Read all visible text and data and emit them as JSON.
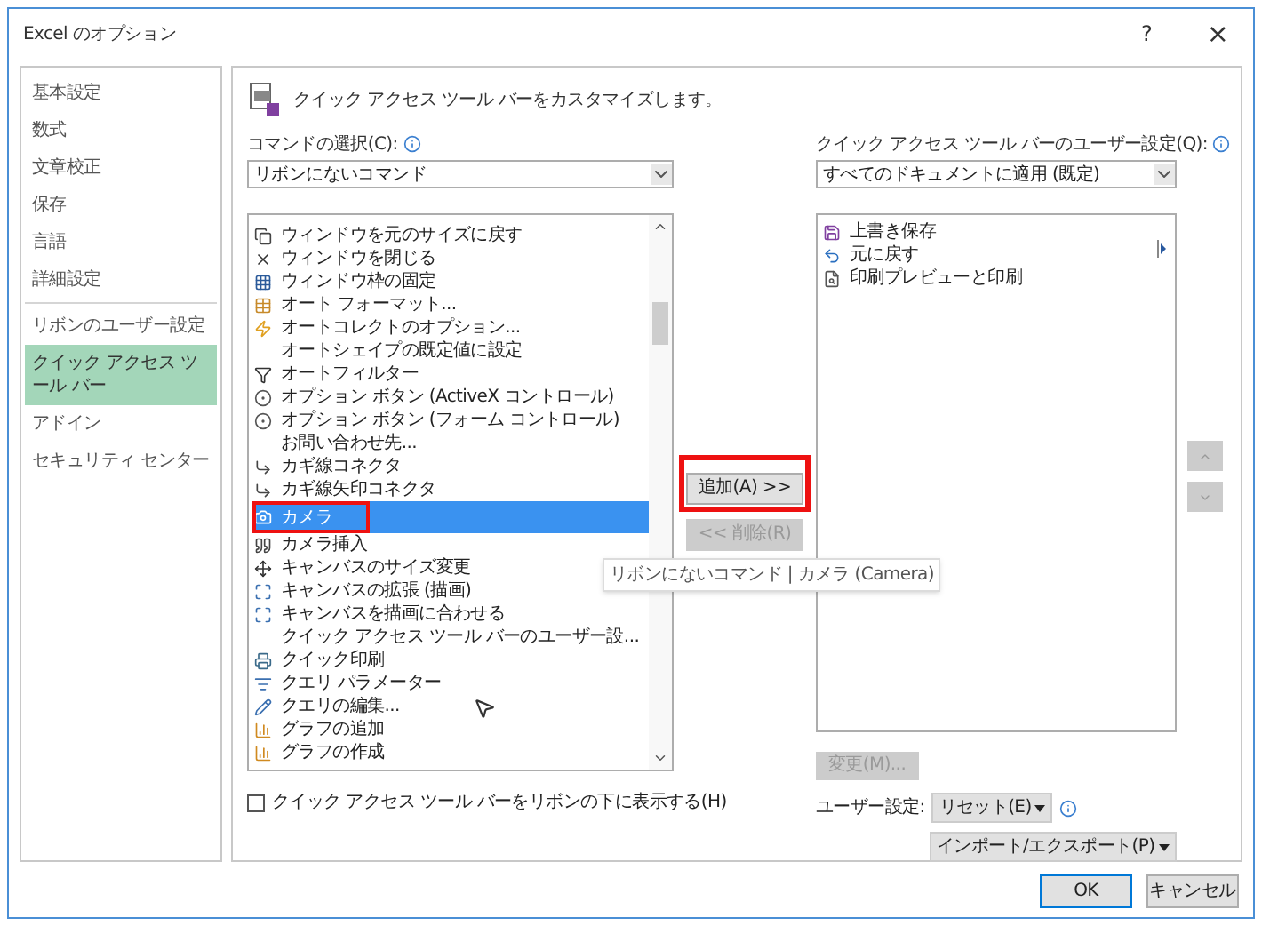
{
  "window": {
    "title": "Excel のオプション",
    "help_button": "?",
    "close_button": "×"
  },
  "sidebar": {
    "sections": [
      [
        {
          "label": "基本設定",
          "selected": false
        },
        {
          "label": "数式",
          "selected": false
        },
        {
          "label": "文章校正",
          "selected": false
        },
        {
          "label": "保存",
          "selected": false
        },
        {
          "label": "言語",
          "selected": false
        },
        {
          "label": "詳細設定",
          "selected": false
        }
      ],
      [
        {
          "label": "リボンのユーザー設定",
          "selected": false
        },
        {
          "label": "クイック アクセス ツール バー",
          "selected": true
        },
        {
          "label": "アドイン",
          "selected": false
        },
        {
          "label": "セキュリティ センター",
          "selected": false
        }
      ]
    ]
  },
  "main": {
    "heading": "クイック アクセス ツール バーをカスタマイズします。",
    "command_label": "コマンドの選択(C):",
    "command_dropdown": {
      "value": "リボンにないコマンド"
    },
    "commands": [
      {
        "label": "ウィンドウを元のサイズに戻す",
        "selected": false
      },
      {
        "label": "ウィンドウを閉じる",
        "selected": false
      },
      {
        "label": "ウィンドウ枠の固定",
        "selected": false
      },
      {
        "label": "オート フォーマット...",
        "selected": false
      },
      {
        "label": "オートコレクトのオプション...",
        "selected": false
      },
      {
        "label": "オートシェイプの既定値に設定",
        "selected": false
      },
      {
        "label": "オートフィルター",
        "selected": false
      },
      {
        "label": "オプション ボタン (ActiveX コントロール)",
        "selected": false
      },
      {
        "label": "オプション ボタン (フォーム コントロール)",
        "selected": false
      },
      {
        "label": "お問い合わせ先...",
        "selected": false
      },
      {
        "label": "カギ線コネクタ",
        "selected": false
      },
      {
        "label": "カギ線矢印コネクタ",
        "selected": false
      },
      {
        "label": "カメラ",
        "selected": true
      },
      {
        "label": "カメラ挿入",
        "selected": false
      },
      {
        "label": "キャンバスのサイズ変更",
        "selected": false
      },
      {
        "label": "キャンバスの拡張 (描画)",
        "selected": false
      },
      {
        "label": "キャンバスを描画に合わせる",
        "selected": false
      },
      {
        "label": "クイック アクセス ツール バーのユーザー設...",
        "selected": false
      },
      {
        "label": "クイック印刷",
        "selected": false
      },
      {
        "label": "クエリ パラメーター",
        "selected": false
      },
      {
        "label": "クエリの編集...",
        "selected": false
      },
      {
        "label": "グラフの追加",
        "selected": false
      },
      {
        "label": "グラフの作成",
        "selected": false
      }
    ],
    "show_below_ribbon": {
      "label": "クイック アクセス ツール バーをリボンの下に表示する(H)",
      "checked": false
    },
    "add_button": {
      "label": "追加(A) >>",
      "disabled": false
    },
    "remove_button": {
      "label": "<< 削除(R)",
      "disabled": true
    },
    "tooltip": "リボンにないコマンド | カメラ (Camera)",
    "toolbar_label": "クイック アクセス ツール バーのユーザー設定(Q):",
    "toolbar_dropdown": {
      "value": "すべてのドキュメントに適用 (既定)"
    },
    "toolbar_items": [
      {
        "label": "上書き保存"
      },
      {
        "label": "元に戻す"
      },
      {
        "label": "印刷プレビューと印刷"
      }
    ],
    "move_up": {
      "disabled": true
    },
    "move_down": {
      "disabled": true
    },
    "modify_button": {
      "label": "変更(M)...",
      "disabled": true
    },
    "customizations_label": "ユーザー設定:",
    "reset_button": {
      "label": "リセット(E)"
    },
    "import_export_button": {
      "label": "インポート/エクスポート(P)"
    }
  },
  "footer": {
    "ok_button": "OK",
    "cancel_button": "キャンセル"
  }
}
